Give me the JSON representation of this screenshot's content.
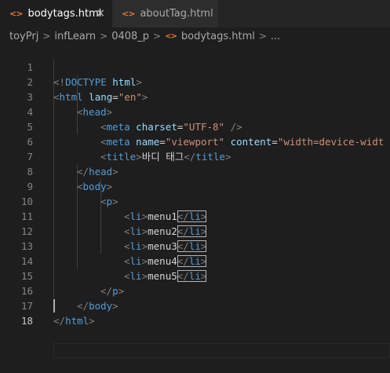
{
  "tabs": [
    {
      "icon": "<>",
      "label": "bodytags.html",
      "close": "×",
      "active": true
    },
    {
      "icon": "<>",
      "label": "aboutTag.html",
      "active": false
    }
  ],
  "breadcrumb": {
    "items": [
      "toyPrj",
      "infLearn",
      "0408_p",
      "bodytags.html",
      "..."
    ],
    "separator": ">"
  },
  "editor": {
    "line_numbers": [
      "1",
      "2",
      "3",
      "4",
      "5",
      "6",
      "7",
      "8",
      "9",
      "10",
      "11",
      "12",
      "13",
      "14",
      "15",
      "16",
      "17",
      "18"
    ],
    "code": {
      "l1": {
        "open": "<!",
        "doctype": "DOCTYPE",
        "html": "html",
        "close": ">"
      },
      "l2": {
        "lt": "<",
        "tag": "html",
        "attr": "lang",
        "eq": "=",
        "val": "\"en\"",
        "gt": ">"
      },
      "l3": {
        "lt": "<",
        "tag": "head",
        "gt": ">"
      },
      "l4": {
        "lt": "<",
        "tag": "meta",
        "attr": "charset",
        "eq": "=",
        "val": "\"UTF-8\"",
        "end": " />"
      },
      "l5": {
        "lt": "<",
        "tag": "meta",
        "attr1": "name",
        "eq1": "=",
        "val1": "\"viewport\"",
        "attr2": "content",
        "eq2": "=",
        "val2": "\"width=device-widt"
      },
      "l6": {
        "lt": "<",
        "tag": "title",
        "gt": ">",
        "text": "바디 태그",
        "lt2": "</",
        "tag2": "title",
        "gt2": ">"
      },
      "l7": {
        "lt": "</",
        "tag": "head",
        "gt": ">"
      },
      "l8": {
        "lt": "<",
        "tag": "body",
        "gt": ">"
      },
      "l9": {
        "lt": "<",
        "tag": "p",
        "gt": ">"
      },
      "items": [
        {
          "lt": "<",
          "tag": "li",
          "gt": ">",
          "text": "menu1",
          "lt2": "</",
          "tag2": "li",
          "gt2": ">"
        },
        {
          "lt": "<",
          "tag": "li",
          "gt": ">",
          "text": "menu2",
          "lt2": "</",
          "tag2": "li",
          "gt2": ">"
        },
        {
          "lt": "<",
          "tag": "li",
          "gt": ">",
          "text": "menu3",
          "lt2": "</",
          "tag2": "li",
          "gt2": ">"
        },
        {
          "lt": "<",
          "tag": "li",
          "gt": ">",
          "text": "menu4",
          "lt2": "</",
          "tag2": "li",
          "gt2": ">"
        },
        {
          "lt": "<",
          "tag": "li",
          "gt": ">",
          "text": "menu5",
          "lt2": "</",
          "tag2": "li",
          "gt2": ">"
        }
      ],
      "l15": {
        "lt": "</",
        "tag": "p",
        "gt": ">"
      },
      "l16": {
        "lt": "</",
        "tag": "body",
        "gt": ">"
      },
      "l17": {
        "lt": "</",
        "tag": "html",
        "gt": ">"
      }
    }
  },
  "colors": {
    "background": "#1e1e1e",
    "tag": "#569cd6",
    "attribute": "#9cdcfe",
    "string": "#ce9178",
    "text": "#d4d4d4",
    "line_number": "#858585",
    "file_icon": "#e37933"
  },
  "icons": [
    "html-file-icon",
    "close-icon",
    "chevron-right-icon"
  ]
}
